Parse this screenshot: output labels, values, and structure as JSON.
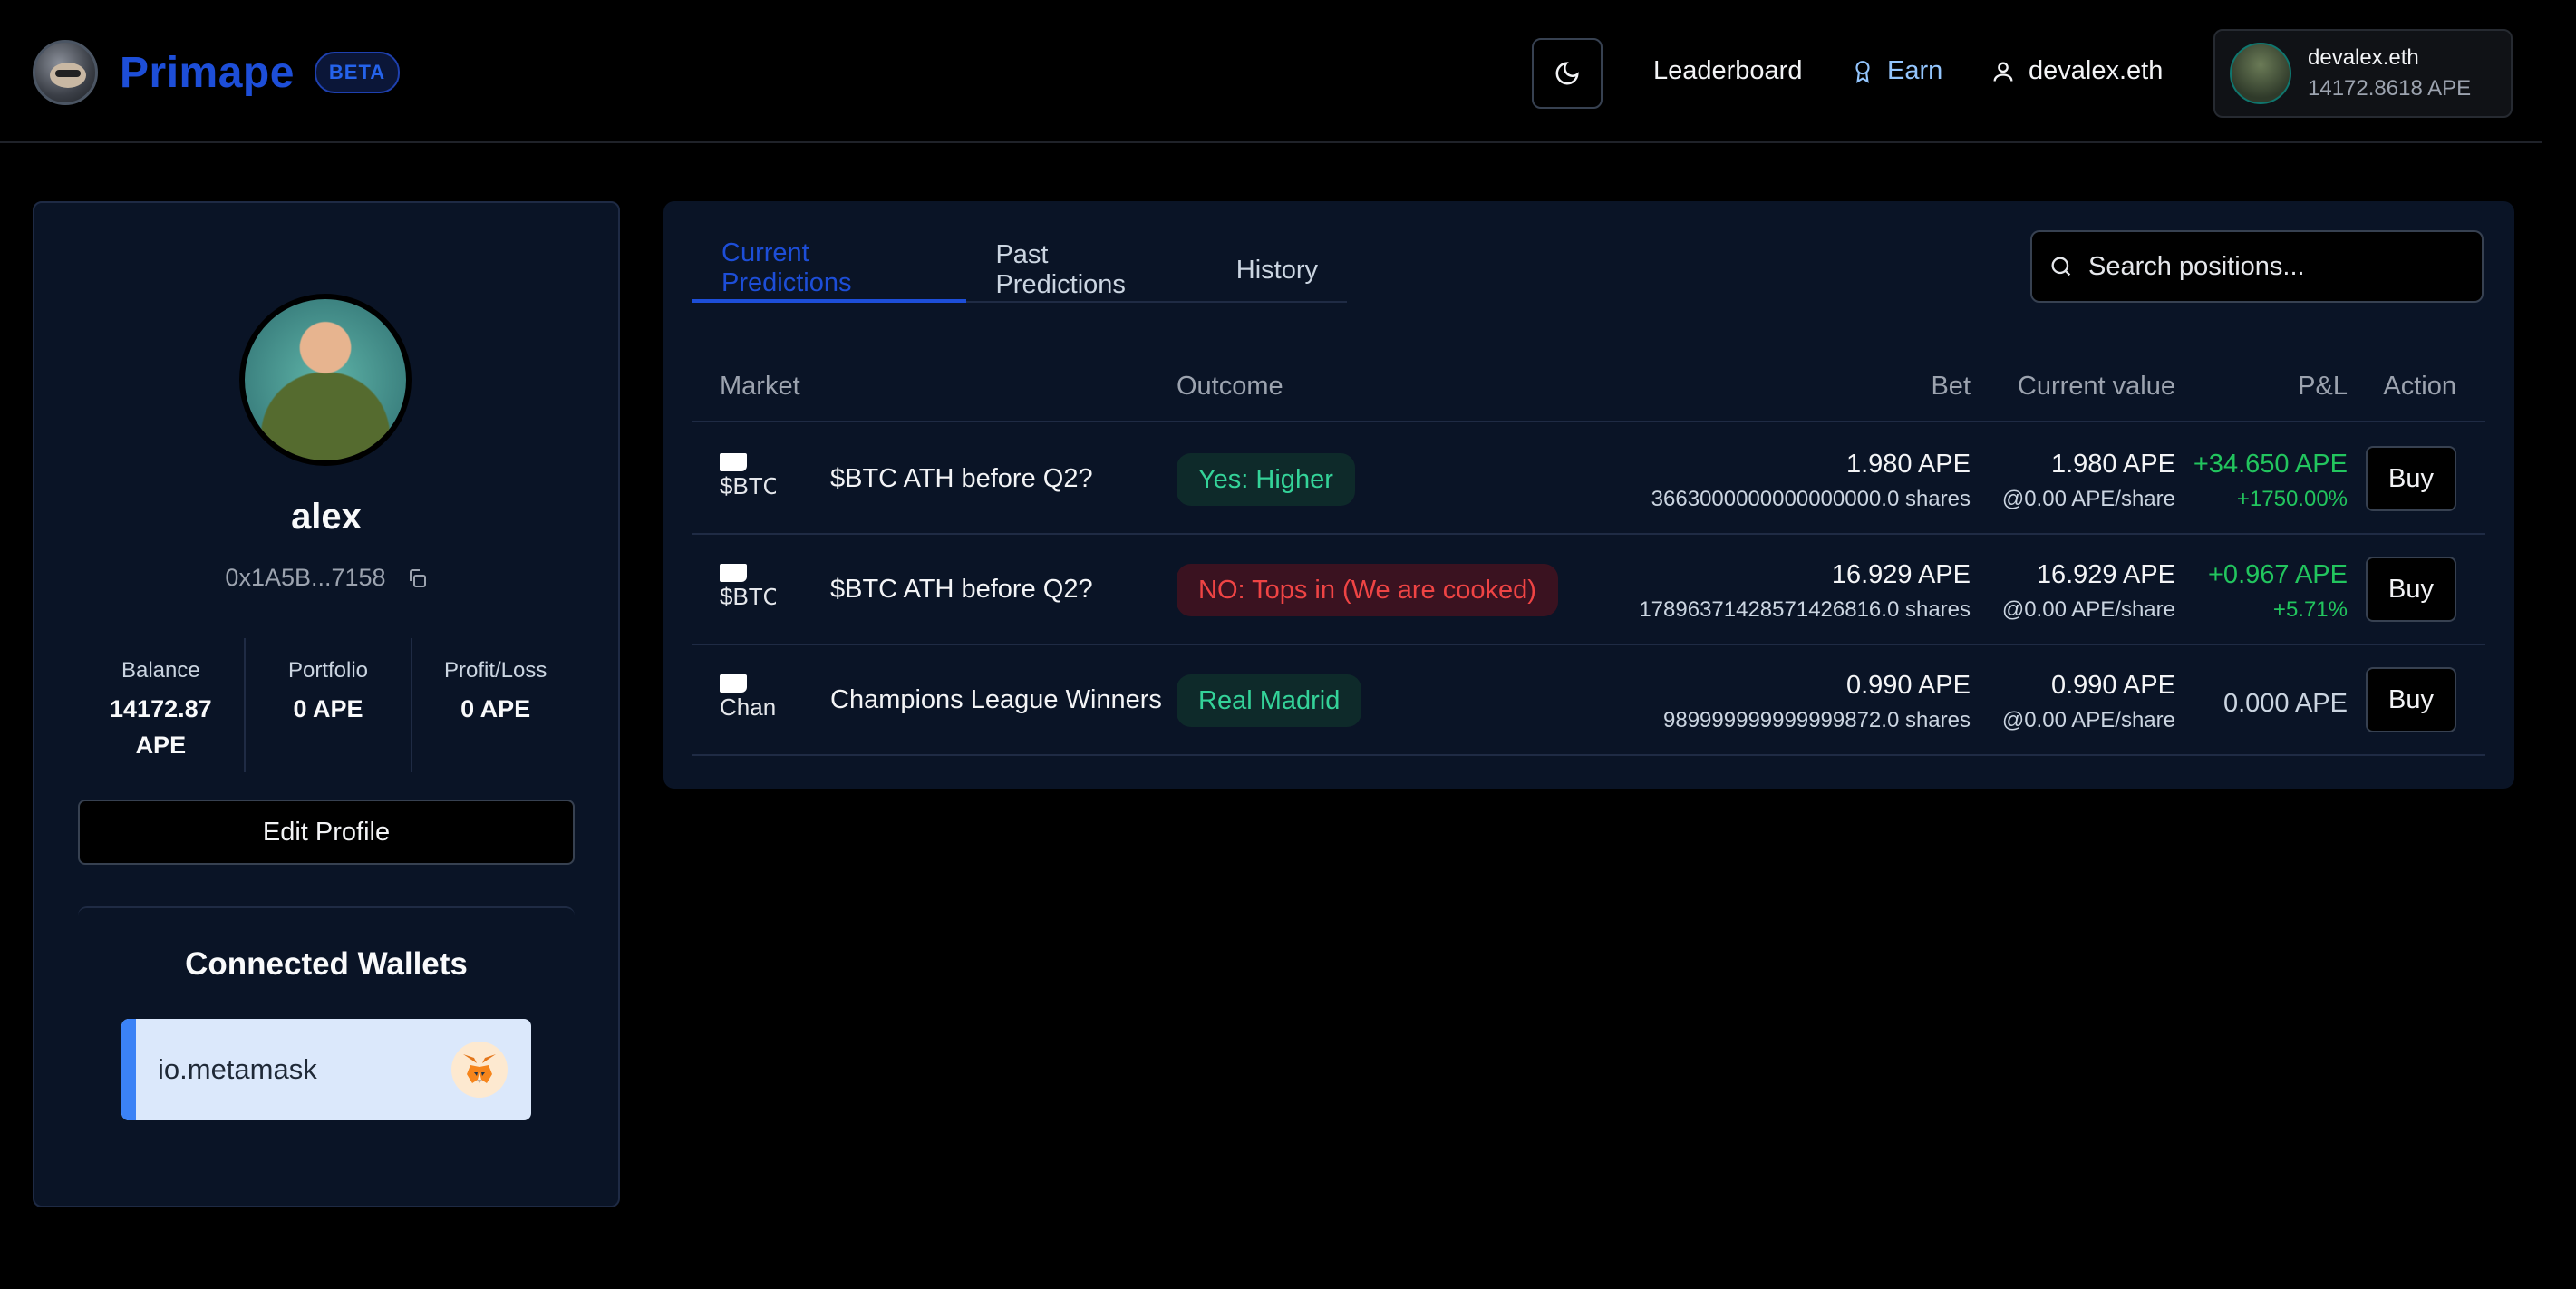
{
  "header": {
    "app_name": "Primape",
    "beta_badge": "BETA",
    "nav": {
      "leaderboard": "Leaderboard",
      "earn": "Earn",
      "user": "devalex.eth"
    },
    "user_card": {
      "name": "devalex.eth",
      "balance": "14172.8618 APE"
    }
  },
  "profile": {
    "name": "alex",
    "address": "0x1A5B...7158",
    "stats": [
      {
        "label": "Balance",
        "value": "14172.87 APE"
      },
      {
        "label": "Portfolio",
        "value": "0 APE"
      },
      {
        "label": "Profit/Loss",
        "value": "0 APE"
      }
    ],
    "edit_button": "Edit Profile",
    "connected_wallets_title": "Connected Wallets",
    "wallets": [
      {
        "name": "io.metamask",
        "icon": "metamask-fox-icon"
      }
    ]
  },
  "main": {
    "tabs": [
      {
        "label": "Current Predictions",
        "active": true
      },
      {
        "label": "Past Predictions",
        "active": false
      },
      {
        "label": "History",
        "active": false
      }
    ],
    "search": {
      "placeholder": "Search positions..."
    },
    "columns": {
      "market": "Market",
      "outcome": "Outcome",
      "bet": "Bet",
      "current_value": "Current value",
      "pnl": "P&L",
      "action": "Action"
    },
    "rows": [
      {
        "img_alt": "$BTC",
        "market": "$BTC ATH before Q2?",
        "outcome": "Yes: Higher",
        "outcome_type": "yes",
        "bet": "1.980 APE",
        "bet_shares": "3663000000000000000.0 shares",
        "current": "1.980 APE",
        "current_price": "@0.00 APE/share",
        "pnl": "+34.650 APE",
        "pnl_pct": "+1750.00%",
        "action": "Buy"
      },
      {
        "img_alt": "$BTC",
        "market": "$BTC ATH before Q2?",
        "outcome": "NO: Tops in (We are cooked)",
        "outcome_type": "no",
        "bet": "16.929 APE",
        "bet_shares": "1789637142857142681​6.0 shares",
        "current": "16.929 APE",
        "current_price": "@0.00 APE/share",
        "pnl": "+0.967 APE",
        "pnl_pct": "+5.71%",
        "action": "Buy"
      },
      {
        "img_alt": "Chan",
        "market": "Champions League Winners",
        "outcome": "Real Madrid",
        "outcome_type": "yes",
        "bet": "0.990 APE",
        "bet_shares": "989999999999999872.0 shares",
        "current": "0.990 APE",
        "current_price": "@0.00 APE/share",
        "pnl": "0.000 APE",
        "pnl_pct": "",
        "action": "Buy"
      }
    ]
  },
  "colors": {
    "accent": "#1d4ed8",
    "positive": "#22c55e",
    "negative": "#ef4444",
    "panel": "#0a1426"
  }
}
